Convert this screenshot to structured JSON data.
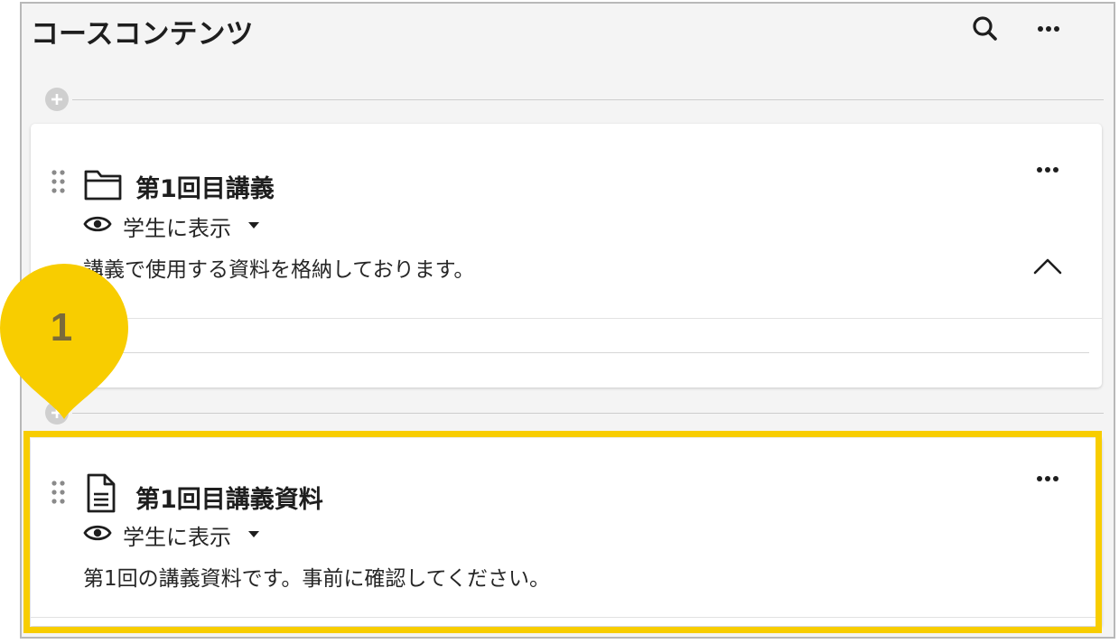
{
  "header": {
    "title": "コースコンテンツ"
  },
  "items": [
    {
      "title": "第1回目講義",
      "visibility": "学生に表示",
      "description": "講義で使用する資料を格納しております。"
    },
    {
      "title": "第1回目講義資料",
      "visibility": "学生に表示",
      "description": "第1回の講義資料です。事前に確認してください。"
    }
  ],
  "callout": {
    "number": "1"
  },
  "colors": {
    "highlight": "#f8cd00",
    "marker": "#f8cd00",
    "background": "#f4f4f4"
  }
}
